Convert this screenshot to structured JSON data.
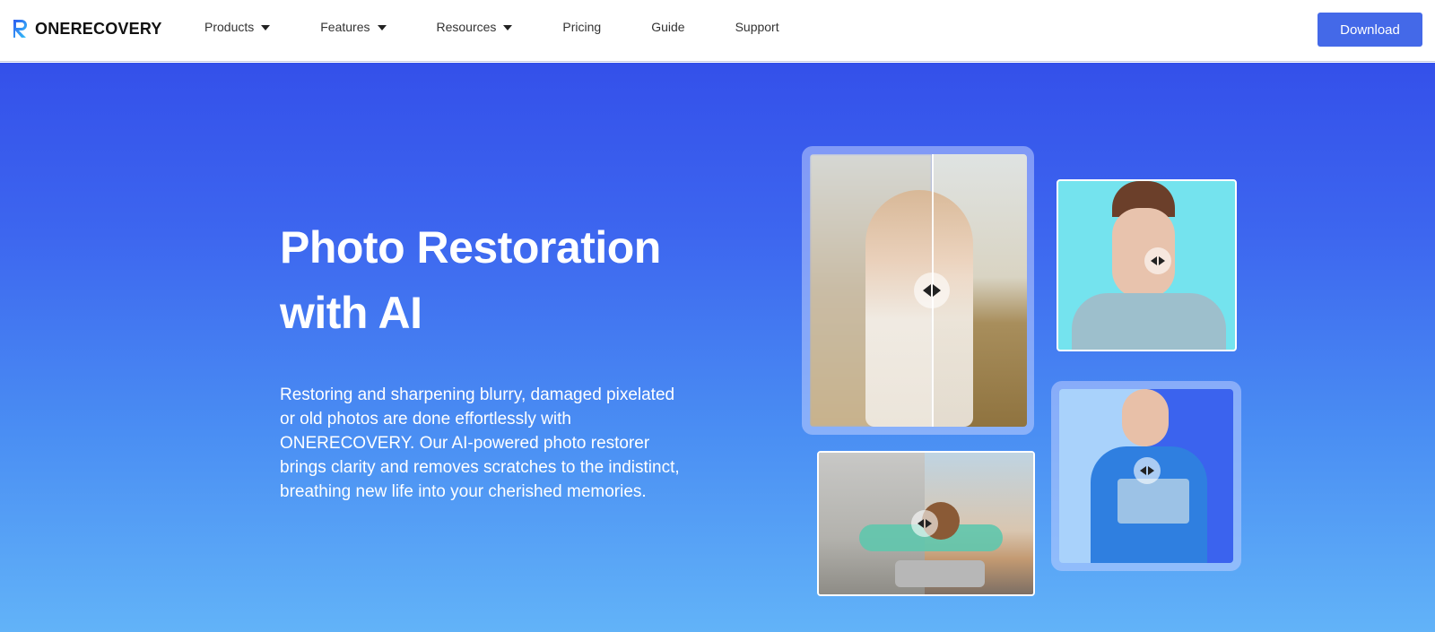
{
  "header": {
    "brand": "ONERECOVERY",
    "nav": [
      {
        "label": "Products",
        "has_dropdown": true
      },
      {
        "label": "Features",
        "has_dropdown": true
      },
      {
        "label": "Resources",
        "has_dropdown": true
      },
      {
        "label": "Pricing",
        "has_dropdown": false
      },
      {
        "label": "Guide",
        "has_dropdown": false
      },
      {
        "label": "Support",
        "has_dropdown": false
      }
    ],
    "download_label": "Download"
  },
  "hero": {
    "title_line1": "Photo Restoration",
    "title_line2": "with AI",
    "description": "Restoring and sharpening blurry, damaged pixelated or old photos are done effortlessly with ONERECOVERY. Our AI-powered photo restorer brings clarity and removes scratches to the indistinct, breathing new life into your cherished memories."
  },
  "gallery": {
    "items": [
      {
        "name": "blurry-woman-comparison",
        "icon": "compare-slider-icon"
      },
      {
        "name": "pixelated-woman-comparison",
        "icon": "compare-slider-icon"
      },
      {
        "name": "scratched-child-comparison",
        "icon": "compare-slider-icon"
      },
      {
        "name": "faded-man-comparison",
        "icon": "compare-slider-icon"
      }
    ]
  },
  "colors": {
    "brand_blue": "#4469e8",
    "hero_top": "#3450ea",
    "hero_bottom": "#62b3f8"
  }
}
